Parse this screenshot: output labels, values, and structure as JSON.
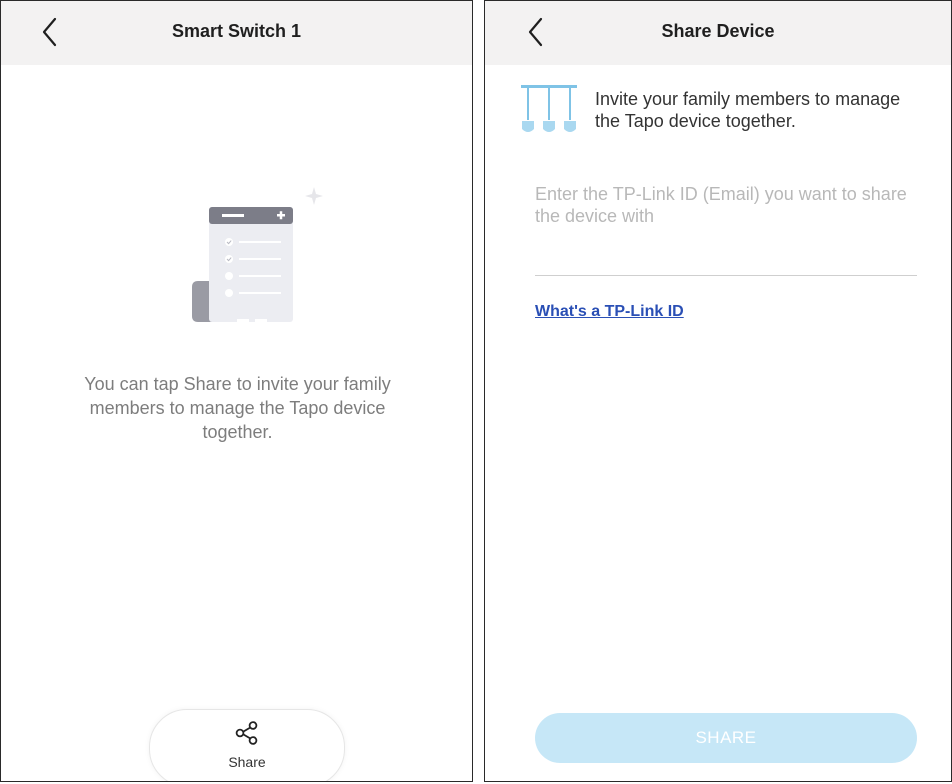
{
  "left_screen": {
    "title": "Smart Switch 1",
    "back_icon": "chevron-left-icon",
    "illustration_icon": "document-list-illustration",
    "empty_message": "You can tap Share to invite your family members to manage the Tapo device together.",
    "share_action": {
      "label": "Share",
      "icon": "share-icon"
    }
  },
  "right_screen": {
    "title": "Share Device",
    "back_icon": "chevron-left-icon",
    "invite_icon": "lamps-icon",
    "invite_text": "Invite your family members to manage the Tapo device together.",
    "email_input": {
      "value": "",
      "placeholder": "Enter the TP-Link ID (Email) you want to share the device with"
    },
    "help_link": "What's a TP-Link ID",
    "share_button": "SHARE"
  },
  "colors": {
    "navbar_bg": "#f3f2f2",
    "link": "#2a4fb5",
    "share_button_bg": "#c6e7f7",
    "icon_blue": "#7fc3e6",
    "muted_text": "#7d7d7d"
  }
}
